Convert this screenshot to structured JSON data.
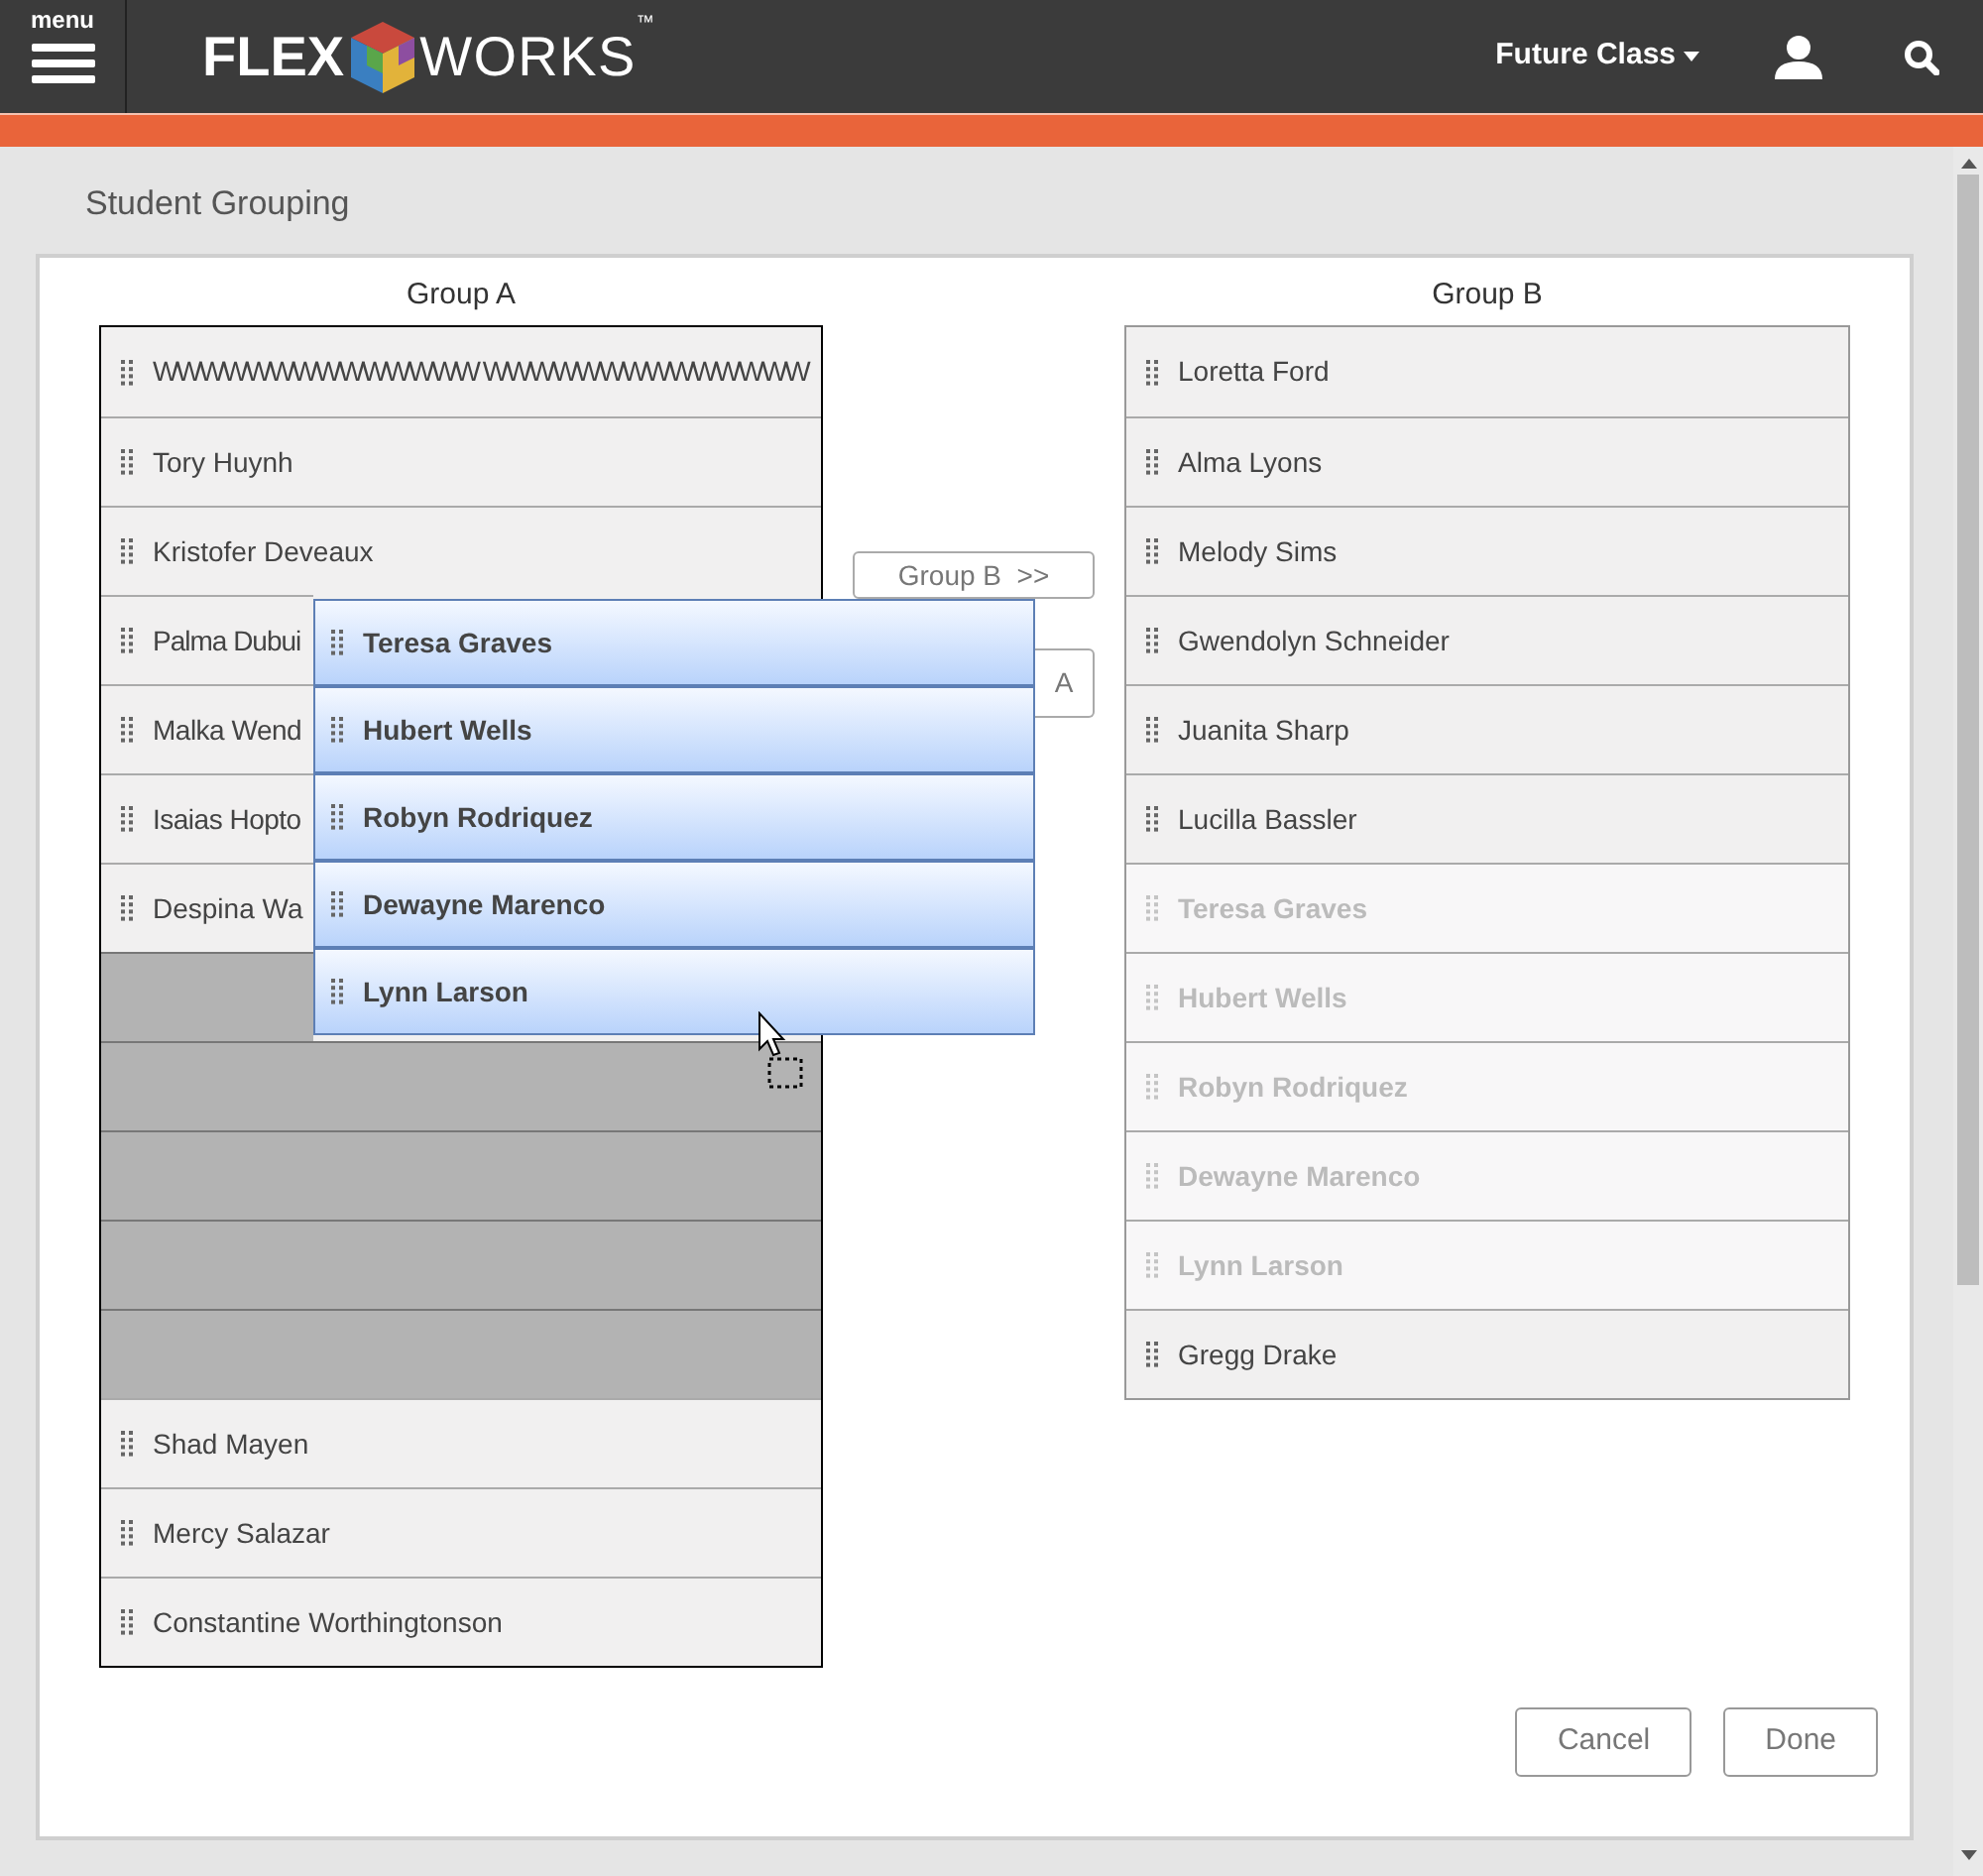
{
  "header": {
    "menu_label": "menu",
    "logo": {
      "bold": "FLEX",
      "light": "WORKS",
      "mark": "™"
    },
    "class_menu": "Future Class"
  },
  "page_title": "Student Grouping",
  "group_a": {
    "title": "Group A",
    "items": [
      {
        "kind": "student",
        "name": "WWWWWWWWWWWWWW WWWWWWWWWWWWWW"
      },
      {
        "kind": "student",
        "name": "Tory Huynh"
      },
      {
        "kind": "student",
        "name": "Kristofer Deveaux"
      },
      {
        "kind": "student",
        "name": "Palma Dubui"
      },
      {
        "kind": "student",
        "name": "Malka Wend"
      },
      {
        "kind": "student",
        "name": "Isaias Hopto"
      },
      {
        "kind": "student",
        "name": "Despina Wa"
      },
      {
        "kind": "drop-slot"
      },
      {
        "kind": "drop-slot"
      },
      {
        "kind": "drop-slot"
      },
      {
        "kind": "drop-slot"
      },
      {
        "kind": "drop-slot"
      },
      {
        "kind": "student",
        "name": "Shad Mayen"
      },
      {
        "kind": "student",
        "name": "Mercy Salazar"
      },
      {
        "kind": "student",
        "name": "Constantine Worthingtonson"
      }
    ]
  },
  "move_buttons": [
    {
      "label": "Group B  >>"
    },
    {
      "label": "A"
    }
  ],
  "group_b": {
    "title": "Group B",
    "items": [
      {
        "name": "Loretta Ford",
        "dimmed": false
      },
      {
        "name": "Alma Lyons",
        "dimmed": false
      },
      {
        "name": "Melody Sims",
        "dimmed": false
      },
      {
        "name": "Gwendolyn Schneider",
        "dimmed": false
      },
      {
        "name": "Juanita Sharp",
        "dimmed": false
      },
      {
        "name": "Lucilla Bassler",
        "dimmed": false
      },
      {
        "name": "Teresa Graves",
        "dimmed": true
      },
      {
        "name": "Hubert Wells",
        "dimmed": true
      },
      {
        "name": "Robyn Rodriquez",
        "dimmed": true
      },
      {
        "name": "Dewayne Marenco",
        "dimmed": true
      },
      {
        "name": "Lynn Larson",
        "dimmed": true
      },
      {
        "name": "Gregg Drake",
        "dimmed": false
      }
    ]
  },
  "drag_items": [
    "Teresa Graves",
    "Hubert Wells",
    "Robyn Rodriquez",
    "Dewayne Marenco",
    "Lynn Larson"
  ],
  "footer_buttons": [
    "Cancel",
    "Done"
  ]
}
